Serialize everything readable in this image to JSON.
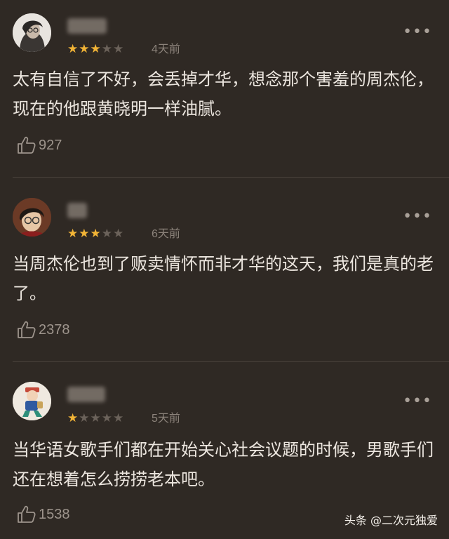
{
  "comments": [
    {
      "username": "夏意",
      "rating": 3,
      "max_rating": 5,
      "date": "4天前",
      "text": "太有自信了不好，会丢掉才华，想念那个害羞的周杰伦，现在的他跟黄晓明一样油腻。",
      "likes": "927",
      "avatar_icon": "user-avatar-icon"
    },
    {
      "username": "Lo",
      "rating": 3,
      "max_rating": 5,
      "date": "6天前",
      "text": "当周杰伦也到了贩卖情怀而非才华的这天，我们是真的老了。",
      "likes": "2378",
      "avatar_icon": "user-avatar-icon"
    },
    {
      "username": "群克",
      "rating": 1,
      "max_rating": 5,
      "date": "5天前",
      "text": "当华语女歌手们都在开始关心社会议题的时候，男歌手们还在想着怎么捞捞老本吧。",
      "likes": "1538",
      "avatar_icon": "user-avatar-icon"
    }
  ],
  "more_symbol": "•••",
  "watermark": "头条 @二次元独爱",
  "colors": {
    "background": "#2f2924",
    "star": "#f2b436",
    "star_off": "#6b625a",
    "muted": "#8c837b"
  }
}
